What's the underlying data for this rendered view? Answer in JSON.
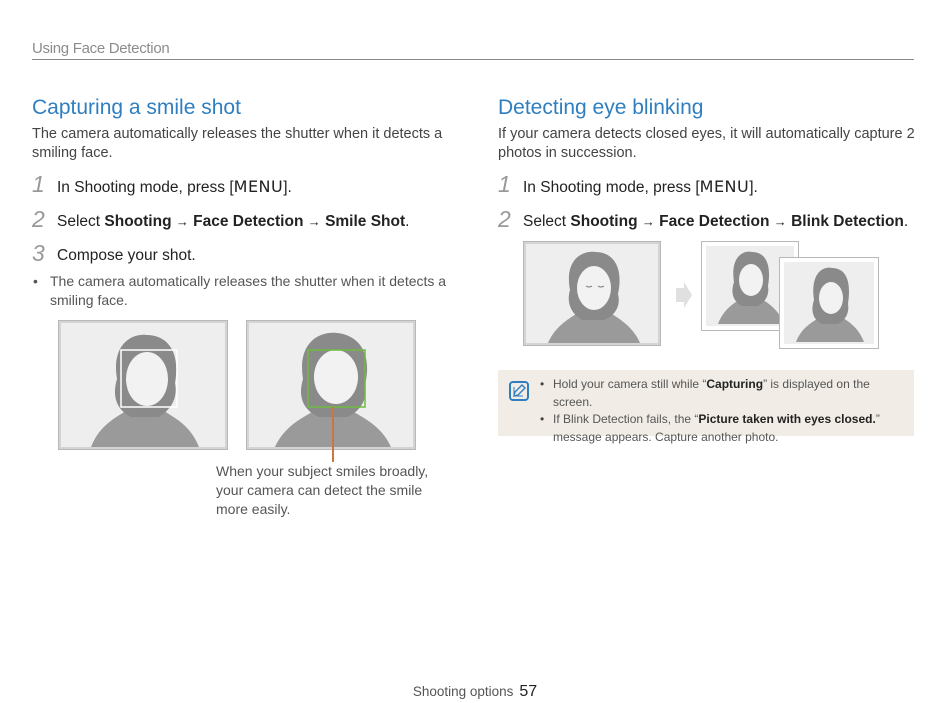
{
  "header": {
    "title": "Using Face Detection"
  },
  "left": {
    "title": "Capturing a smile shot",
    "intro": "The camera automatically releases the shutter when it detects a smiling face.",
    "steps": [
      {
        "num": "1",
        "pre": "In Shooting mode, press [",
        "key": "MENU",
        "post": "]."
      },
      {
        "num": "2",
        "pre": "Select ",
        "p1": "Shooting",
        "arrow1": "→",
        "p2": "Face Detection",
        "arrow2": "→",
        "p3": "Smile Shot",
        "post": "."
      },
      {
        "num": "3",
        "text": "Compose your shot."
      }
    ],
    "bullet": "The camera automatically releases the shutter when it detects a smiling face.",
    "caption": "When your subject smiles broadly, your camera can detect the smile more easily."
  },
  "right": {
    "title": "Detecting eye blinking",
    "intro": "If your camera detects closed eyes, it will automatically capture 2 photos in succession.",
    "steps": [
      {
        "num": "1",
        "pre": "In Shooting mode, press [",
        "key": "MENU",
        "post": "]."
      },
      {
        "num": "2",
        "pre": "Select ",
        "p1": "Shooting",
        "arrow1": "→",
        "p2": "Face Detection",
        "arrow2": "→",
        "p3": "Blink Detection",
        "post": "."
      }
    ]
  },
  "note": {
    "icon": "note-pencil-icon",
    "item1_pre": "Hold your camera still while “",
    "item1_bold": "Capturing",
    "item1_post": "” is displayed on the screen.",
    "item2_pre": "If Blink Detection fails, the “",
    "item2_bold": "Picture taken with eyes closed.",
    "item2_post": "” message appears. Capture another photo."
  },
  "footer": {
    "section": "Shooting options",
    "page": "57"
  },
  "colors": {
    "accent": "#2f7fc0",
    "pointer": "#c9773e",
    "detect_box": "#6dbb3f",
    "note_bg": "#f1ede6"
  }
}
